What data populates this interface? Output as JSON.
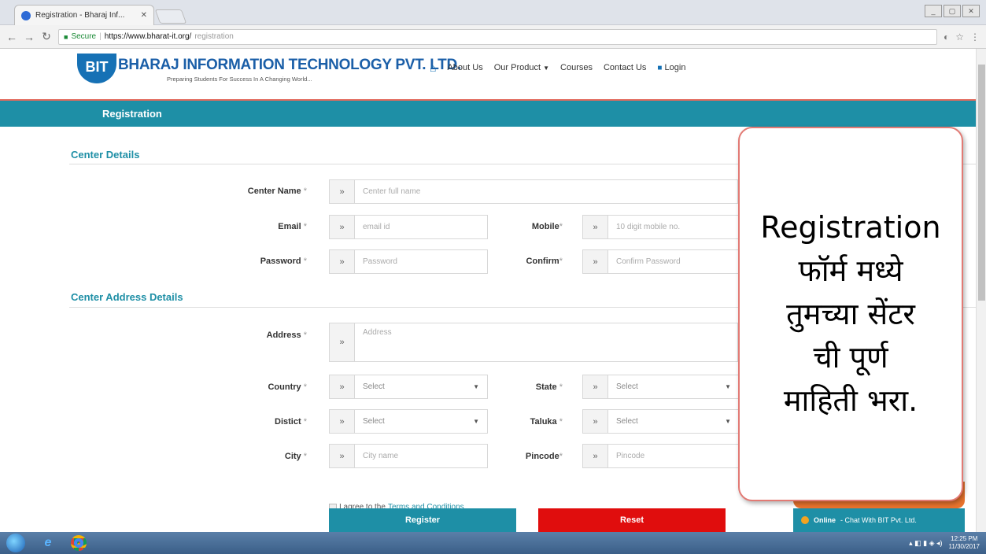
{
  "browser": {
    "tab_title": "Registration - Bharaj Inf...",
    "tab_close": "✕",
    "secure_label": "Secure",
    "url_host": "https://www.bharat-it.org/",
    "url_path": "registration",
    "window_controls": [
      "_",
      "▢",
      "✕"
    ]
  },
  "site": {
    "logo_mark": "BIT",
    "brand": "BHARAJ INFORMATION TECHNOLOGY PVT. LTD.",
    "tagline": "Preparing Students For Success In A Changing World...",
    "nav": {
      "about": "About Us",
      "product": "Our Product",
      "courses": "Courses",
      "contact": "Contact Us",
      "login": "Login"
    },
    "page_title": "Registration"
  },
  "form": {
    "section_center": "Center Details",
    "section_address": "Center Address Details",
    "addon": "»",
    "center_name": {
      "label": "Center Name",
      "placeholder": "Center full name"
    },
    "email": {
      "label": "Email",
      "placeholder": "email id"
    },
    "mobile": {
      "label": "Mobile",
      "placeholder": "10 digit mobile no."
    },
    "password": {
      "label": "Password",
      "placeholder": "Password"
    },
    "confirm": {
      "label": "Confirm",
      "placeholder": "Confirm Password"
    },
    "address": {
      "label": "Address",
      "placeholder": "Address"
    },
    "country": {
      "label": "Country",
      "value": "Select"
    },
    "state": {
      "label": "State",
      "value": "Select"
    },
    "district": {
      "label": "Distict",
      "value": "Select"
    },
    "taluka": {
      "label": "Taluka",
      "value": "Select"
    },
    "city": {
      "label": "City",
      "placeholder": "City name"
    },
    "pincode": {
      "label": "Pincode",
      "placeholder": "Pincode"
    },
    "required_mark": "*",
    "agree_text": "I agree to the",
    "terms_text": "Terms and Conditions",
    "register_button": "Register",
    "reset_button": "Reset"
  },
  "callout": {
    "lines": [
      "Registration",
      "फॉर्म मध्ये",
      "तुमच्या सेंटर",
      "ची पूर्ण",
      "माहिती भरा."
    ]
  },
  "chat": {
    "status": "Online",
    "text": "- Chat With BIT Pvt. Ltd."
  },
  "taskbar": {
    "time": "12:25 PM",
    "date": "11/30/2017"
  },
  "colors": {
    "accent": "#1e8fa6",
    "reset": "#e00d0d",
    "callout_border": "#e27a74",
    "brand": "#1b5fa8"
  }
}
